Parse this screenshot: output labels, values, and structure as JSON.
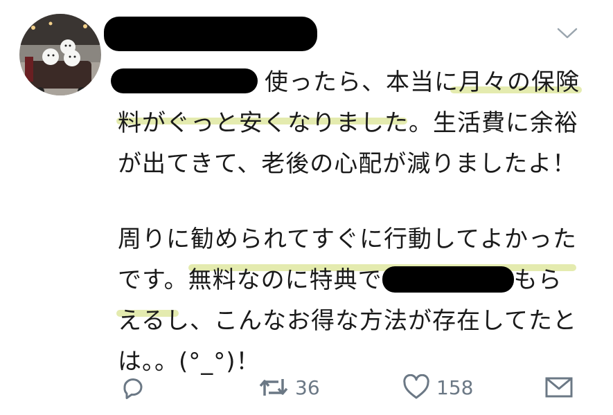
{
  "tweet": {
    "lines": [
      "使ったら、本当に月々の保険",
      "料がぐっと安くなりました。生活費に余裕",
      "が出てきて、老後の心配が減りましたよ！",
      "",
      "周りに勧められてすぐに行動してよかった",
      "です。無料なのに特典で",
      "もら",
      "えるし、こんなお得な方法が存在してたと",
      "は。。(°_°)！"
    ]
  },
  "actions": {
    "reply_icon": "reply-icon",
    "retweet_icon": "retweet-icon",
    "retweet_count": "36",
    "like_icon": "heart-icon",
    "like_count": "158",
    "dm_icon": "mail-icon"
  },
  "colors": {
    "text": "#1a1a1a",
    "icon_gray": "#6b7885",
    "highlight": "#cdda6e",
    "redaction": "#000000"
  }
}
